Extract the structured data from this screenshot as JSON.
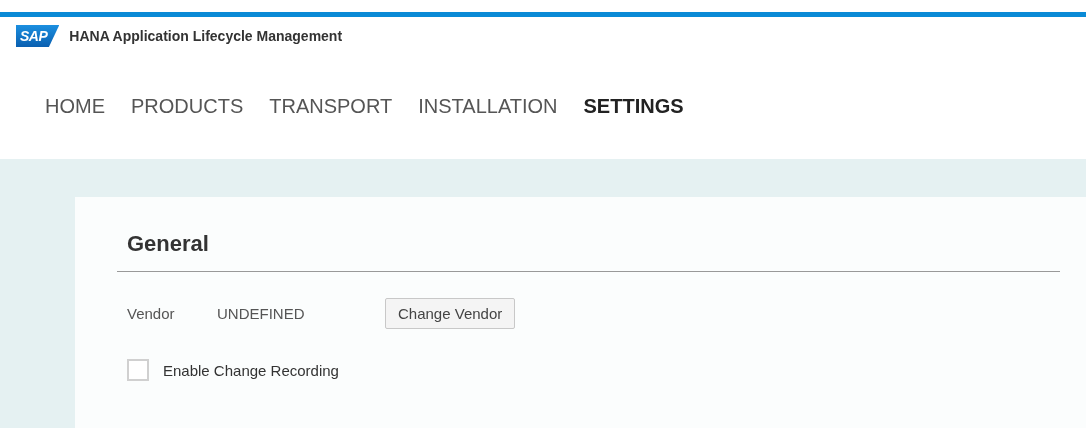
{
  "header": {
    "logo": "SAP",
    "title": "HANA Application Lifecycle Management"
  },
  "tabs": [
    {
      "label": "HOME",
      "selected": false
    },
    {
      "label": "PRODUCTS",
      "selected": false
    },
    {
      "label": "TRANSPORT",
      "selected": false
    },
    {
      "label": "INSTALLATION",
      "selected": false
    },
    {
      "label": "SETTINGS",
      "selected": true
    }
  ],
  "section": {
    "title": "General",
    "vendor_label": "Vendor",
    "vendor_value": "UNDEFINED",
    "button": "Change Vendor",
    "checkbox": {
      "label": "Enable Change Recording",
      "checked": false
    }
  }
}
